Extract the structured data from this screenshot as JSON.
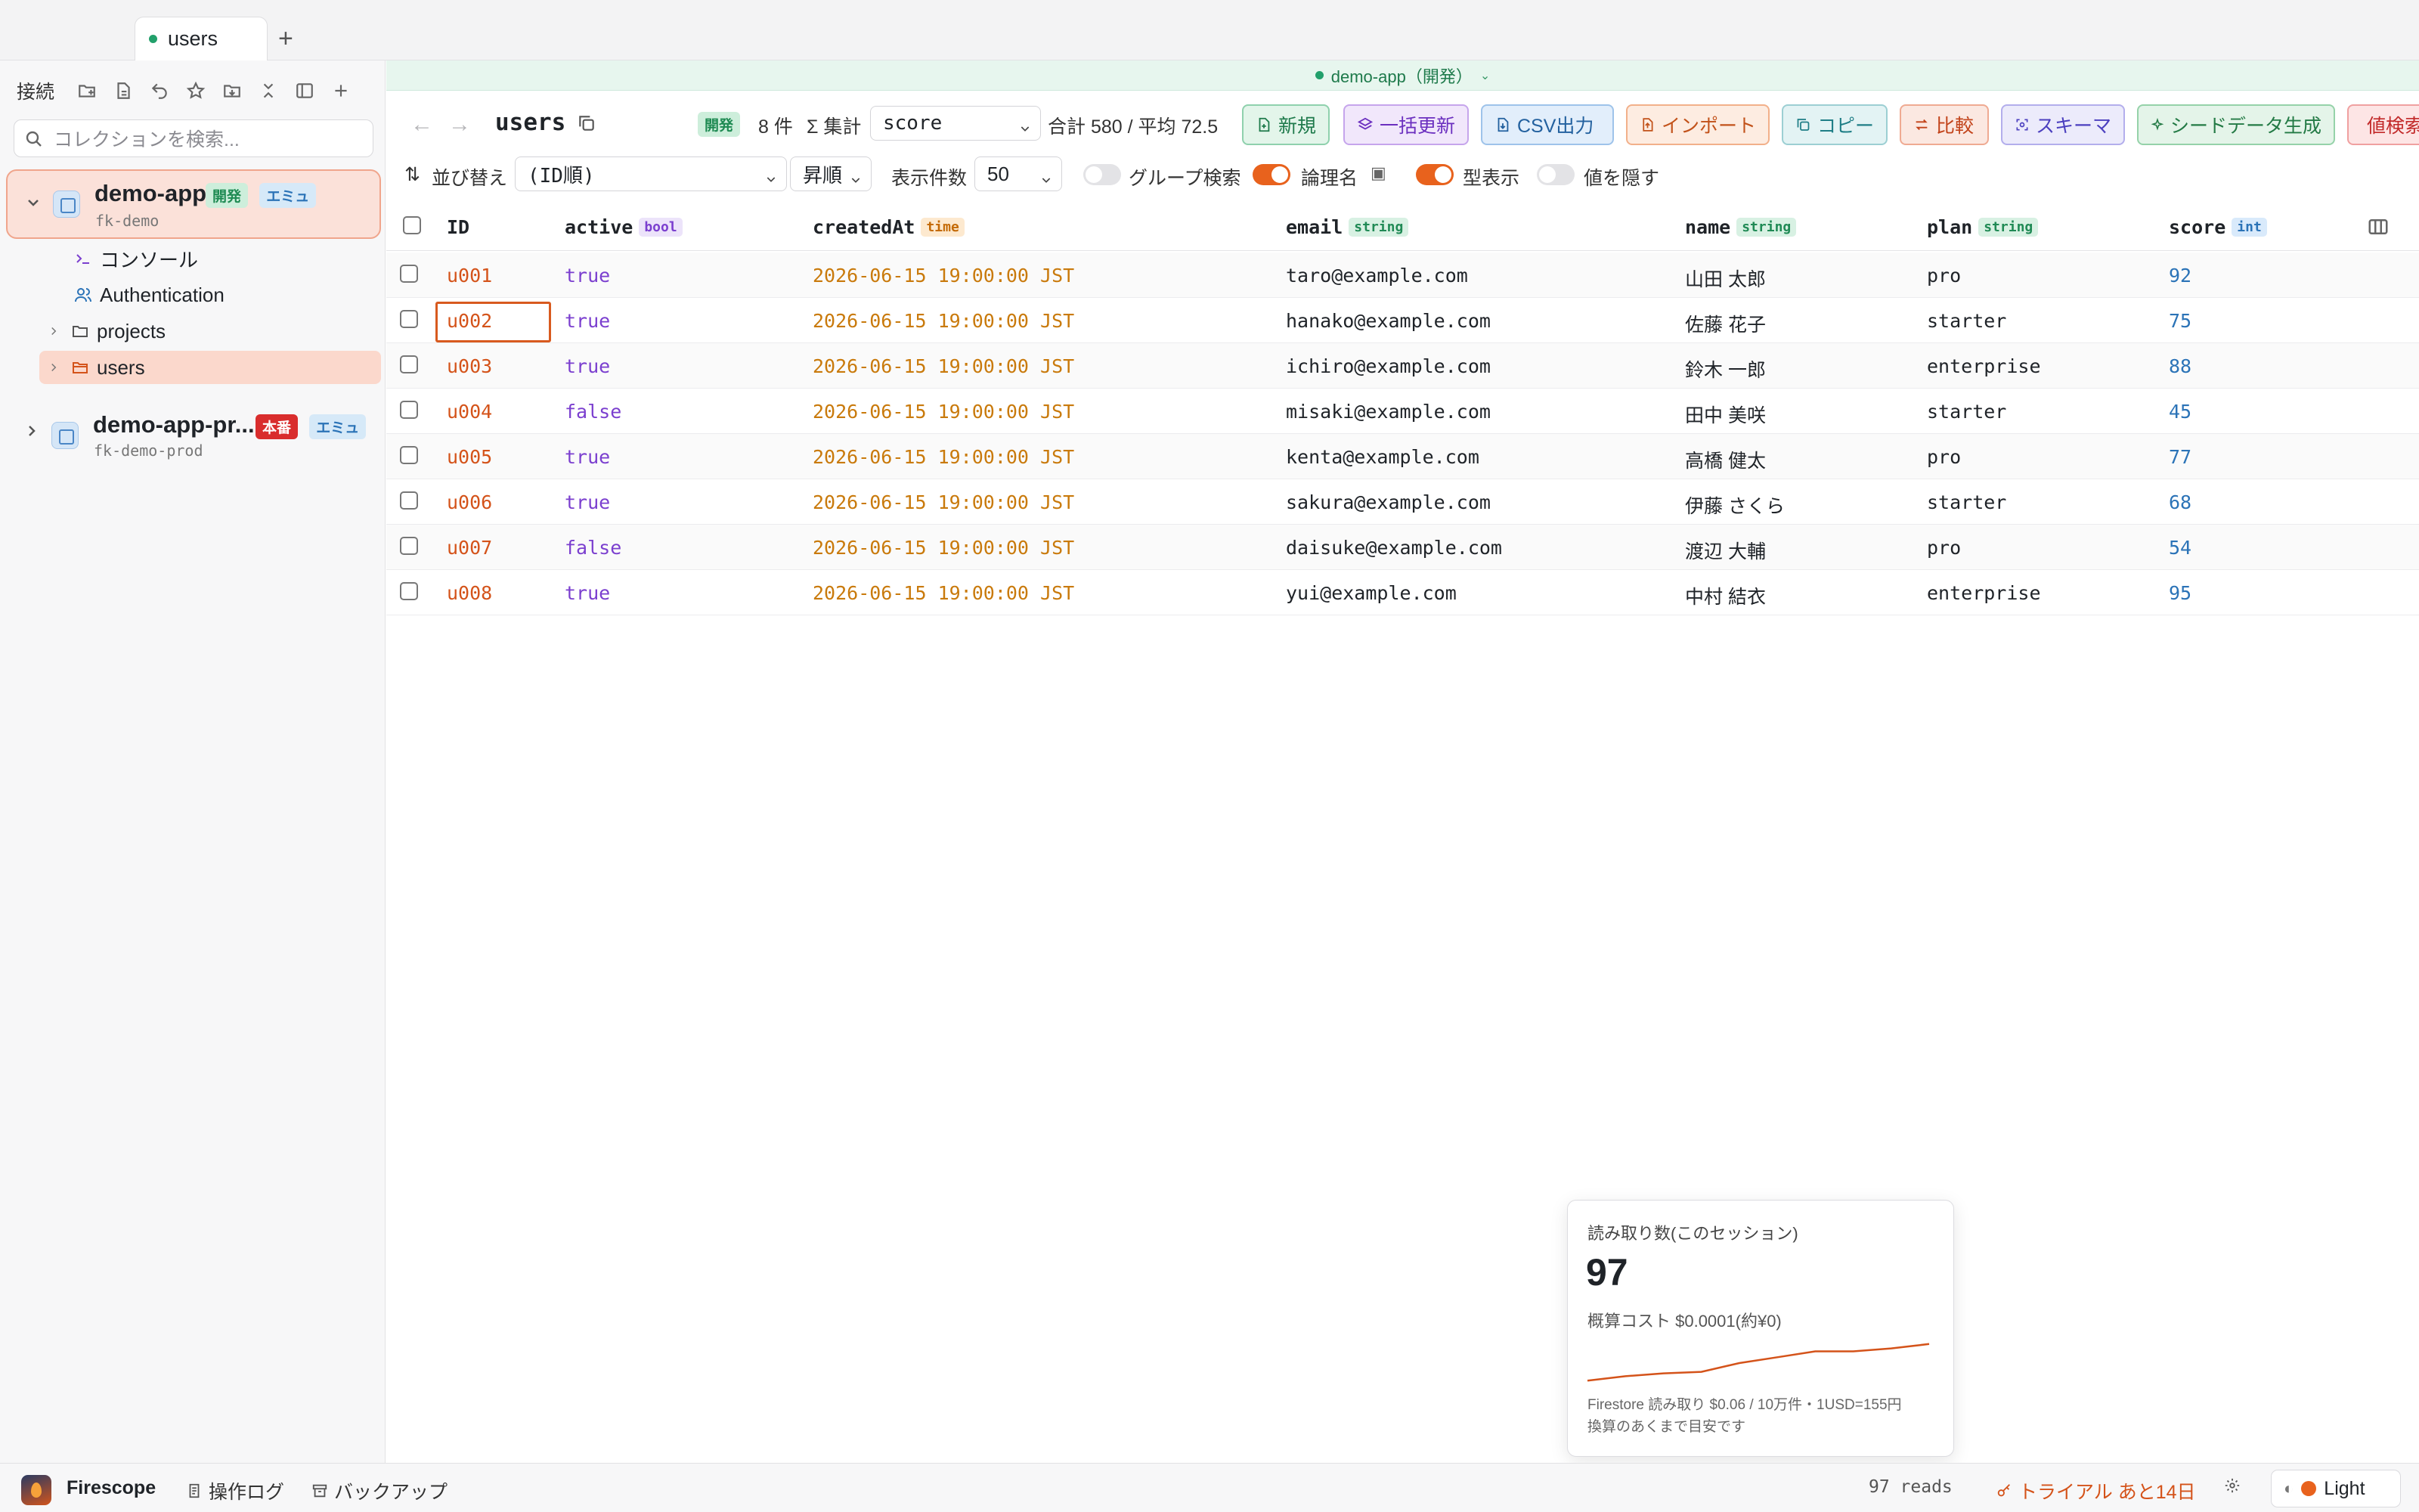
{
  "tabbar": {
    "active_tab": "users",
    "add_label": "+"
  },
  "sidebar": {
    "header_label": "接続",
    "search_placeholder": "コレクションを検索...",
    "connections": [
      {
        "name": "demo-app",
        "project": "fk-demo",
        "badges": [
          "開発",
          "エミュ"
        ],
        "expanded": true
      },
      {
        "name": "demo-app-pr...",
        "project": "fk-demo-prod",
        "badges": [
          "本番",
          "エミュ"
        ],
        "expanded": false
      }
    ],
    "tree": [
      {
        "label": "コンソール",
        "icon": "terminal-icon"
      },
      {
        "label": "Authentication",
        "icon": "users-icon"
      },
      {
        "label": "projects",
        "icon": "folder-icon"
      },
      {
        "label": "users",
        "icon": "folder-open-icon",
        "selected": true
      }
    ]
  },
  "envbar": {
    "label": "demo-app（開発）"
  },
  "toolbar": {
    "title": "users",
    "env_badge": "開発",
    "count": "8 件",
    "aggregate_label": "Σ 集計",
    "aggregate_field": "score",
    "sum_text": "合計 580 / 平均 72.5",
    "buttons": [
      {
        "label": "新規",
        "icon": "file-plus-icon"
      },
      {
        "label": "一括更新",
        "icon": "layers-icon"
      },
      {
        "label": "CSV出力",
        "icon": "file-export-icon"
      },
      {
        "label": "インポート",
        "icon": "file-import-icon"
      },
      {
        "label": "コピー",
        "icon": "copy-icon"
      },
      {
        "label": "比較",
        "icon": "compare-icon"
      },
      {
        "label": "スキーマ",
        "icon": "schema-icon"
      },
      {
        "label": "シードデータ生成",
        "icon": "sparkle-icon"
      },
      {
        "label": "値検索",
        "icon": "search-icon"
      }
    ]
  },
  "sortbar": {
    "sort_label": "並び替え",
    "sort_value": "(ID順)",
    "order_value": "昇順",
    "page_size_label": "表示件数",
    "page_size_value": "50",
    "group_search_label": "グループ検索",
    "group_search_on": false,
    "logical_name_label": "論理名",
    "logical_name_on": true,
    "type_display_label": "型表示",
    "type_display_on": true,
    "hide_values_label": "値を隠す",
    "hide_values_on": false
  },
  "table": {
    "columns": [
      {
        "name": "ID",
        "type": ""
      },
      {
        "name": "active",
        "type": "bool"
      },
      {
        "name": "createdAt",
        "type": "time"
      },
      {
        "name": "email",
        "type": "string"
      },
      {
        "name": "name",
        "type": "string"
      },
      {
        "name": "plan",
        "type": "string"
      },
      {
        "name": "score",
        "type": "int"
      }
    ],
    "rows": [
      {
        "id": "u001",
        "active": "true",
        "createdAt": "2026-06-15 19:00:00 JST",
        "email": "taro@example.com",
        "name": "山田 太郎",
        "plan": "pro",
        "score": "92"
      },
      {
        "id": "u002",
        "active": "true",
        "createdAt": "2026-06-15 19:00:00 JST",
        "email": "hanako@example.com",
        "name": "佐藤 花子",
        "plan": "starter",
        "score": "75"
      },
      {
        "id": "u003",
        "active": "true",
        "createdAt": "2026-06-15 19:00:00 JST",
        "email": "ichiro@example.com",
        "name": "鈴木 一郎",
        "plan": "enterprise",
        "score": "88"
      },
      {
        "id": "u004",
        "active": "false",
        "createdAt": "2026-06-15 19:00:00 JST",
        "email": "misaki@example.com",
        "name": "田中 美咲",
        "plan": "starter",
        "score": "45"
      },
      {
        "id": "u005",
        "active": "true",
        "createdAt": "2026-06-15 19:00:00 JST",
        "email": "kenta@example.com",
        "name": "高橋 健太",
        "plan": "pro",
        "score": "77"
      },
      {
        "id": "u006",
        "active": "true",
        "createdAt": "2026-06-15 19:00:00 JST",
        "email": "sakura@example.com",
        "name": "伊藤 さくら",
        "plan": "starter",
        "score": "68"
      },
      {
        "id": "u007",
        "active": "false",
        "createdAt": "2026-06-15 19:00:00 JST",
        "email": "daisuke@example.com",
        "name": "渡辺 大輔",
        "plan": "pro",
        "score": "54"
      },
      {
        "id": "u008",
        "active": "true",
        "createdAt": "2026-06-15 19:00:00 JST",
        "email": "yui@example.com",
        "name": "中村 結衣",
        "plan": "enterprise",
        "score": "95"
      }
    ]
  },
  "popover": {
    "label": "読み取り数(このセッション)",
    "value": "97",
    "cost": "概算コスト $0.0001(約¥0)",
    "note_line1": "Firestore 読み取り $0.06 / 10万件・1USD=155円",
    "note_line2": "換算のあくまで目安です",
    "spark": [
      8,
      14,
      18,
      20,
      32,
      40,
      48,
      48,
      52,
      58
    ]
  },
  "statusbar": {
    "app_name": "Firescope",
    "log_label": "操作ログ",
    "backup_label": "バックアップ",
    "reads": "97 reads",
    "trial": "トライアル あと14日",
    "theme": "Light"
  },
  "colors": {
    "accent": "#e8621d",
    "env_green": "#22a06b",
    "prod_red": "#d92d2d"
  }
}
